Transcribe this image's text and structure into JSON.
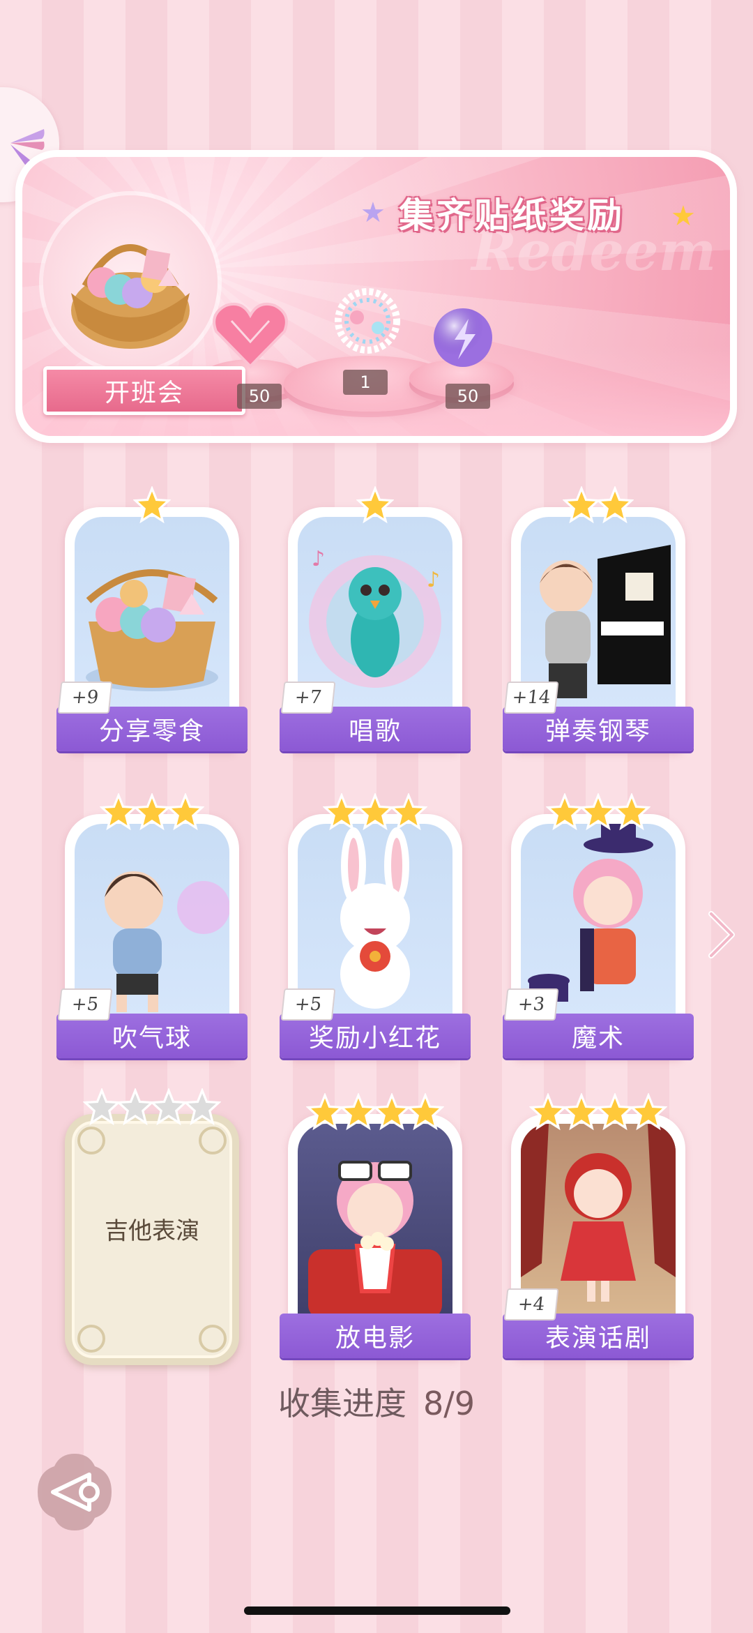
{
  "reward_panel": {
    "title": "集齐贴纸奖励",
    "watermark": "Redeem",
    "event_label": "开班会",
    "rewards": [
      {
        "icon": "heart-gem-icon",
        "count": "50"
      },
      {
        "icon": "pearl-bracelet-icon",
        "count": "1"
      },
      {
        "icon": "lightning-orb-icon",
        "count": "50"
      }
    ]
  },
  "cards": [
    {
      "name": "分享零食",
      "stars": 1,
      "bonus": "+9",
      "art": "snack-basket-icon",
      "locked": false
    },
    {
      "name": "唱歌",
      "stars": 1,
      "bonus": "+7",
      "art": "singing-peacock-icon",
      "locked": false
    },
    {
      "name": "弹奏钢琴",
      "stars": 2,
      "bonus": "+14",
      "art": "boy-piano-icon",
      "locked": false
    },
    {
      "name": "吹气球",
      "stars": 3,
      "bonus": "+5",
      "art": "boy-bubblegum-icon",
      "locked": false
    },
    {
      "name": "奖励小红花",
      "stars": 3,
      "bonus": "+5",
      "art": "bunny-flower-icon",
      "locked": false
    },
    {
      "name": "魔术",
      "stars": 3,
      "bonus": "+3",
      "art": "magician-girl-icon",
      "locked": false
    },
    {
      "name": "吉他表演",
      "stars": 4,
      "bonus": "",
      "art": "",
      "locked": true
    },
    {
      "name": "放电影",
      "stars": 4,
      "bonus": "",
      "art": "girl-popcorn-icon",
      "locked": false
    },
    {
      "name": "表演话剧",
      "stars": 4,
      "bonus": "+4",
      "art": "girl-stage-icon",
      "locked": false
    }
  ],
  "progress": {
    "label": "收集进度",
    "value": "8/9"
  },
  "colors": {
    "accent_purple": "#8c59d4",
    "star_gold": "#ffc93a",
    "pink": "#f49bb1"
  }
}
